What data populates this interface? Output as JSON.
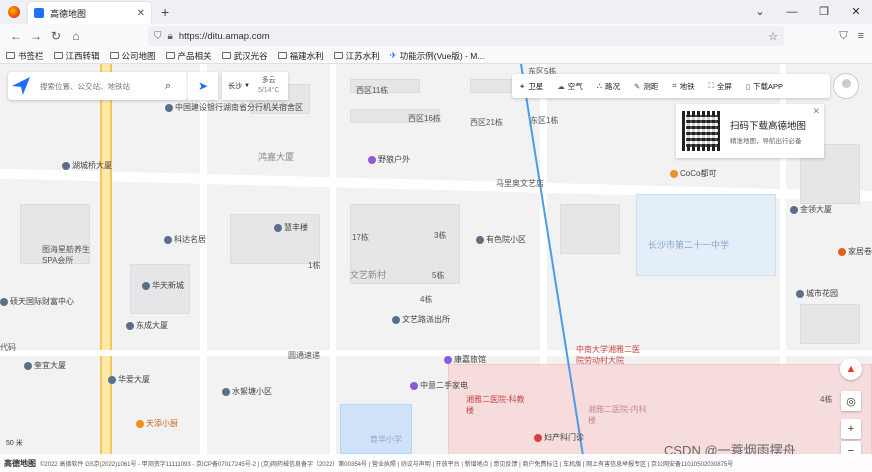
{
  "browser": {
    "tab_title": "高德地图",
    "url": "https://ditu.amap.com",
    "bookmarks": [
      "书签栏",
      "江西转辑",
      "公司地图",
      "产品相关",
      "武汉光谷",
      "福建水利",
      "江苏水利",
      "功能示例(Vue版) - M..."
    ]
  },
  "search": {
    "placeholder": "搜索位置、公交站、地铁站"
  },
  "city": {
    "name": "长沙",
    "weather": "多云",
    "temp": "5/14°C"
  },
  "toolbar": [
    "卫星",
    "空气",
    "路况",
    "测距",
    "地铁",
    "全屏",
    "下载APP"
  ],
  "qr": {
    "title": "扫码下载高德地图",
    "subtitle": "精准地图，导航出行必备"
  },
  "scale": "50 米",
  "watermark": "CSDN @一蓑烟雨摆舟",
  "footer": {
    "brand": "高德地图",
    "text": "©2022 高德软件 GS京(2022)1061号 - 甲测资字11111093 - 京ICP备07017245号-2 | (京)网药械信息备字（2022）第00354号 | 营业执照 | 协议与声明 | 开放平台 | 新增地点 | 意见反馈 | 商户免费标注 | 车机版 | 网上有害信息举报专区 | 京公网安备11010502030875号"
  },
  "labels": [
    "中国建设银行湖南省分行机关宿舍区",
    "西区11栋",
    "西区16栋",
    "西区21栋",
    "东区5栋",
    "东区1栋",
    "鸿嘉大厦",
    "野狼户外",
    "马里奥文艺店",
    "CoCo都可",
    "金领大厦",
    "长沙市第二十一中学",
    "家居卷",
    "城市花园",
    "湖城桥大厦",
    "图海星舫养生SPA会所",
    "科达名居",
    "慧丰楼",
    "17栋",
    "3栋",
    "1栋",
    "有色院小区",
    "5栋",
    "文艺新村",
    "华天新城",
    "东成大厦",
    "文艺路派出所",
    "硕天国际财富中心",
    "奎宜大厦",
    "中南大学湘雅二医院劳动村大院",
    "康嘉旅馆",
    "圆通速递",
    "华爱大厦",
    "水絮塘小区",
    "中意二手家电",
    "湘雅二医院-科教楼",
    "湘雅二医院-内科楼",
    "天添小厨",
    "育华小学",
    "妇产科门诊",
    "代码",
    "4栋",
    "4栋"
  ]
}
